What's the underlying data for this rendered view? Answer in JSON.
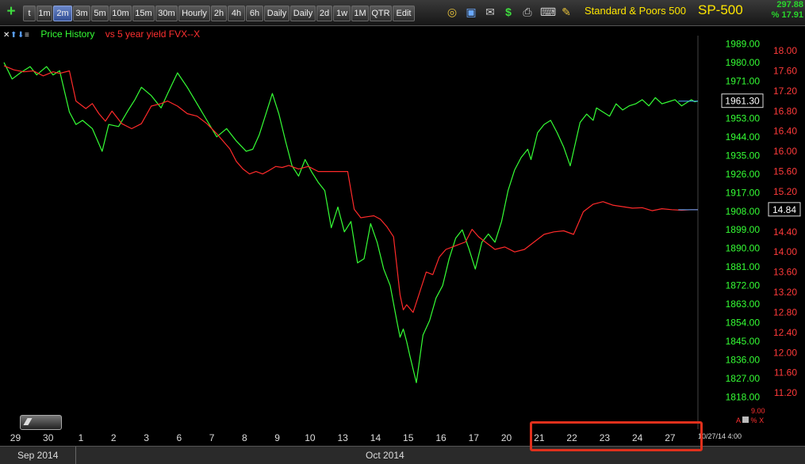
{
  "toolbar": {
    "intervals": [
      "t",
      "1m",
      "2m",
      "3m",
      "5m",
      "10m",
      "15m",
      "30m",
      "Hourly",
      "2h",
      "4h",
      "6h",
      "Daily",
      "Daily",
      "2d",
      "1w",
      "1M",
      "QTR",
      "Edit"
    ],
    "active": "2m",
    "icons": [
      "plus-icon",
      "lock-icon",
      "save-icon",
      "mail-icon",
      "dollar-icon",
      "print-icon",
      "keyboard-icon",
      "pencil-icon"
    ]
  },
  "symbol": {
    "description": "Standard & Poors 500",
    "ticker": "SP-500",
    "change": "297.88",
    "pct_change": "% 17.91"
  },
  "legend": {
    "price_label": "Price History",
    "vs_label": "vs 5 year yield FVX--X"
  },
  "bottom": {
    "sep_label": "Sep 2014",
    "oct_label": "Oct 2014",
    "datetime": "10/27/14 4:00",
    "vol_value": "9.00",
    "vol_tag": "A",
    "vol_pct": "%",
    "vol_x": "X"
  },
  "colors": {
    "price": "#35ff35",
    "yield": "#ff2a2a",
    "highlight": "#e0301c"
  },
  "chart_data": {
    "type": "line",
    "x_ticks": [
      "29",
      "30",
      "1",
      "2",
      "3",
      "6",
      "7",
      "8",
      "9",
      "10",
      "13",
      "14",
      "15",
      "16",
      "17",
      "20",
      "21",
      "22",
      "23",
      "24",
      "27"
    ],
    "x_range": [
      0,
      21.2
    ],
    "y_left": {
      "label": "SP-500",
      "ticks": [
        "1989.00",
        "1980.00",
        "1971.00",
        "1962.00",
        "1953.00",
        "1944.00",
        "1935.00",
        "1926.00",
        "1917.00",
        "1908.00",
        "1899.00",
        "1890.00",
        "1881.00",
        "1872.00",
        "1863.00",
        "1854.00",
        "1845.00",
        "1836.00",
        "1827.00",
        "1818.00"
      ],
      "range": [
        1814,
        1993
      ],
      "last": "1961.30"
    },
    "y_right": {
      "label": "FVX",
      "ticks": [
        "18.00",
        "17.60",
        "17.20",
        "16.80",
        "16.40",
        "16.00",
        "15.60",
        "15.20",
        "14.80",
        "14.40",
        "14.00",
        "13.60",
        "13.20",
        "12.80",
        "12.40",
        "12.00",
        "11.60",
        "11.20"
      ],
      "range": [
        10.95,
        18.3
      ],
      "last": "14.84"
    },
    "series": [
      {
        "name": "Price History",
        "x": [
          0,
          0.25,
          0.5,
          0.8,
          1.0,
          1.3,
          1.5,
          1.7,
          2.0,
          2.2,
          2.4,
          2.7,
          3.0,
          3.2,
          3.5,
          3.8,
          4.0,
          4.2,
          4.5,
          4.8,
          5.0,
          5.3,
          5.6,
          5.9,
          6.2,
          6.5,
          6.8,
          7.1,
          7.4,
          7.6,
          7.8,
          8.0,
          8.2,
          8.4,
          8.6,
          8.8,
          9.0,
          9.2,
          9.4,
          9.6,
          9.8,
          10.0,
          10.2,
          10.4,
          10.6,
          10.8,
          11.0,
          11.2,
          11.4,
          11.6,
          11.8,
          12.0,
          12.1,
          12.2,
          12.3,
          12.4,
          12.6,
          12.8,
          13.0,
          13.2,
          13.4,
          13.6,
          13.8,
          14.0,
          14.2,
          14.4,
          14.6,
          14.8,
          15.0,
          15.2,
          15.4,
          15.6,
          15.8,
          16.0,
          16.1,
          16.3,
          16.5,
          16.7,
          16.9,
          17.1,
          17.3,
          17.6,
          17.8,
          18.0,
          18.1,
          18.3,
          18.5,
          18.7,
          18.9,
          19.1,
          19.3,
          19.5,
          19.7,
          19.9,
          20.1,
          20.3,
          20.5,
          20.7,
          20.9,
          21.0,
          21.1,
          21.2
        ],
        "y": [
          1980,
          1972,
          1975,
          1978,
          1974,
          1978,
          1974,
          1976,
          1956,
          1950,
          1952,
          1948,
          1937,
          1950,
          1949,
          1957,
          1962,
          1968,
          1964,
          1958,
          1965,
          1975,
          1968,
          1960,
          1952,
          1944,
          1948,
          1942,
          1937,
          1938,
          1945,
          1955,
          1965,
          1955,
          1942,
          1930,
          1925,
          1933,
          1927,
          1922,
          1918,
          1900,
          1910,
          1898,
          1903,
          1883,
          1885,
          1902,
          1893,
          1880,
          1872,
          1855,
          1847,
          1851,
          1845,
          1838,
          1825,
          1848,
          1855,
          1866,
          1872,
          1885,
          1895,
          1899,
          1890,
          1880,
          1893,
          1897,
          1893,
          1903,
          1918,
          1928,
          1934,
          1938,
          1933,
          1946,
          1950,
          1952,
          1946,
          1939,
          1930,
          1951,
          1955,
          1952,
          1958,
          1956,
          1954,
          1960,
          1957,
          1959,
          1960,
          1962,
          1959,
          1963,
          1960,
          1961,
          1962,
          1959,
          1961,
          1962,
          1961,
          1961.3
        ]
      },
      {
        "name": "vs 5 year yield FVX--X",
        "x": [
          0,
          0.3,
          0.6,
          0.9,
          1.2,
          1.5,
          1.7,
          2.0,
          2.2,
          2.5,
          2.7,
          2.9,
          3.1,
          3.3,
          3.6,
          3.9,
          4.2,
          4.5,
          4.8,
          5.0,
          5.3,
          5.6,
          5.9,
          6.2,
          6.5,
          6.7,
          6.9,
          7.1,
          7.3,
          7.5,
          7.7,
          7.9,
          8.1,
          8.3,
          8.5,
          8.7,
          9.0,
          9.3,
          9.6,
          9.9,
          10.2,
          10.5,
          10.7,
          10.9,
          11.1,
          11.3,
          11.5,
          11.7,
          11.9,
          12.1,
          12.2,
          12.3,
          12.5,
          12.7,
          12.9,
          13.1,
          13.3,
          13.5,
          13.7,
          13.9,
          14.1,
          14.3,
          14.5,
          14.7,
          15.0,
          15.3,
          15.6,
          15.9,
          16.2,
          16.5,
          16.8,
          17.1,
          17.4,
          17.7,
          18.0,
          18.3,
          18.6,
          18.9,
          19.2,
          19.5,
          19.8,
          20.1,
          20.4,
          20.7,
          21.0,
          21.2
        ],
        "y": [
          17.7,
          17.62,
          17.58,
          17.6,
          17.5,
          17.58,
          17.55,
          17.6,
          17.0,
          16.85,
          16.95,
          16.75,
          16.6,
          16.8,
          16.55,
          16.45,
          16.55,
          16.9,
          16.95,
          17.0,
          16.9,
          16.75,
          16.7,
          16.55,
          16.35,
          16.2,
          16.05,
          15.8,
          15.65,
          15.55,
          15.6,
          15.55,
          15.62,
          15.7,
          15.68,
          15.72,
          15.65,
          15.7,
          15.6,
          15.6,
          15.6,
          15.6,
          14.85,
          14.68,
          14.7,
          14.72,
          14.65,
          14.5,
          14.3,
          13.15,
          12.85,
          12.95,
          12.8,
          13.2,
          13.6,
          13.55,
          13.9,
          14.05,
          14.1,
          14.15,
          14.2,
          14.45,
          14.3,
          14.2,
          14.05,
          14.1,
          14.0,
          14.05,
          14.2,
          14.35,
          14.4,
          14.42,
          14.35,
          14.8,
          14.95,
          15.0,
          14.93,
          14.9,
          14.87,
          14.88,
          14.82,
          14.86,
          14.84,
          14.83,
          14.84,
          14.84
        ]
      }
    ],
    "grid": false,
    "legend": "top-left"
  }
}
